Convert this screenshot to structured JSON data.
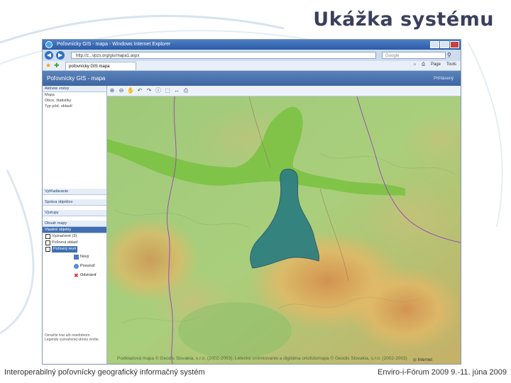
{
  "slide": {
    "title": "Ukážka systému",
    "footer_left": "Interoperabilný poľovnícky geografický informačný systém",
    "footer_right": "Enviro-i-Fórum 2009 9.-11. júna 2009"
  },
  "browser": {
    "window_title": "Poľovnícky GIS - mapa - Windows Internet Explorer",
    "url": "http://z...vpzs.org/gis/mapa1.aspx",
    "search_placeholder": "Google",
    "tab_label": "poľovnícky GIS mapa",
    "tools": [
      "Page",
      "Tools"
    ],
    "status": "Internet"
  },
  "app": {
    "header_title": "Poľovnícky GIS - mapa",
    "header_right": "Prihlásený",
    "panel_head": "Aktívne vrstvy",
    "layer_list": [
      "Mapa",
      "Obce, štatistiky",
      "Typ pôd. oblastí"
    ],
    "section_heads": [
      "Vyhľadávanie",
      "Správa objektov",
      "Výstupy",
      "Obsah mapy"
    ],
    "active_head": "Vlastné objekty",
    "checks": [
      "Vyznačené (3)",
      "Poľovná oblasť",
      "Poľovný revír"
    ],
    "buttons": [
      "Nový",
      "Posunúť",
      "Odstrániť"
    ],
    "footer_note": "Označte tvar a/b onedobrom. Legendu vyznačenej ubnou zvolte.",
    "map_credit": "Podkladová mapa © Geodis Slovakia, s.r.o. (2002-2003), Letecké snímkovanie a digitálna ortofotomapa © Geodis Slovakia, s.r.o. (2002-2003)"
  },
  "icons": {
    "toolbar": [
      "zoom-in-icon",
      "zoom-out-icon",
      "pan-icon",
      "back-icon",
      "forward-icon",
      "info-icon",
      "select-icon",
      "measure-icon",
      "print-icon"
    ]
  },
  "colors": {
    "title": "#3a3f5c",
    "header_blue": "#3c64a0",
    "hunting_ground": "#2f7f7f",
    "protected_area": "#7bc243"
  }
}
